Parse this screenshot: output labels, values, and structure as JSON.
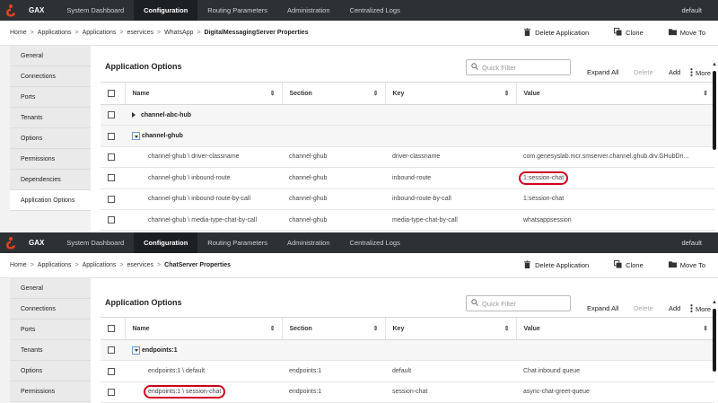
{
  "colors": {
    "nav_bg": "#2d3134",
    "nav_active_bg": "#1d2023",
    "logo": "#e8411e",
    "highlight_ring": "#d0021b",
    "sidebar_bg": "#eaeaea"
  },
  "panels": [
    {
      "nav": {
        "app_name": "GAX",
        "items": [
          "System Dashboard",
          "Configuration",
          "Routing Parameters",
          "Administration",
          "Centralized Logs"
        ],
        "active_index": 1,
        "user": "default"
      },
      "breadcrumb": {
        "items": [
          "Home",
          "Applications",
          "Applications",
          "eservices",
          "WhatsApp"
        ],
        "current": "DigitalMessagingServer Properties"
      },
      "actions": {
        "delete": "Delete Application",
        "clone": "Clone",
        "move": "Move To"
      },
      "sidebar": {
        "items": [
          "General",
          "Connections",
          "Ports",
          "Tenants",
          "Options",
          "Permissions",
          "Dependencies",
          "Application Options"
        ],
        "active_index": 7
      },
      "section_title": "Application Options",
      "filter_placeholder": "Quick Filter",
      "toolbar": {
        "expand_all": "Expand All",
        "delete": "Delete",
        "add": "Add",
        "more": "More"
      },
      "table": {
        "columns": [
          "Name",
          "Section",
          "Key",
          "Value"
        ],
        "rows": [
          {
            "type": "group",
            "name": "channel-abc-hub",
            "expanded": false
          },
          {
            "type": "group",
            "name": "channel-ghub",
            "expanded": true
          },
          {
            "type": "item",
            "name": "channel-ghub \\ driver-classname",
            "section": "channel-ghub",
            "key": "driver-classname",
            "value": "com.genesyslab.mcr.smserver.channel.ghub.drv.GHubDri..."
          },
          {
            "type": "item",
            "name": "channel-ghub \\ inbound-route",
            "section": "channel-ghub",
            "key": "inbound-route",
            "value": "1:session-chat",
            "highlight": "value"
          },
          {
            "type": "item",
            "name": "channel-ghub \\ inbound-route-by-call",
            "section": "channel-ghub",
            "key": "inbound-route-by-call",
            "value": "1:session-chat"
          },
          {
            "type": "item",
            "name": "channel-ghub \\ media-type-chat-by-call",
            "section": "channel-ghub",
            "key": "media-type-chat-by-call",
            "value": "whatsappsession"
          }
        ]
      }
    },
    {
      "nav": {
        "app_name": "GAX",
        "items": [
          "System Dashboard",
          "Configuration",
          "Routing Parameters",
          "Administration",
          "Centralized Logs"
        ],
        "active_index": 1,
        "user": "default"
      },
      "breadcrumb": {
        "items": [
          "Home",
          "Applications",
          "Applications",
          "eservices"
        ],
        "current": "ChatServer Properties"
      },
      "actions": {
        "delete": "Delete Application",
        "clone": "Clone",
        "move": "Move To"
      },
      "sidebar": {
        "items": [
          "General",
          "Connections",
          "Ports",
          "Tenants",
          "Options",
          "Permissions"
        ],
        "active_index": -1
      },
      "section_title": "Application Options",
      "filter_placeholder": "Quick Filter",
      "toolbar": {
        "expand_all": "Expand All",
        "delete": "Delete",
        "add": "Add",
        "more": "More"
      },
      "table": {
        "columns": [
          "Name",
          "Section",
          "Key",
          "Value"
        ],
        "rows": [
          {
            "type": "group",
            "name": "endpoints:1",
            "expanded": true
          },
          {
            "type": "item",
            "name": "endpoints:1 \\ default",
            "section": "endpoints:1",
            "key": "default",
            "value": "Chat inbound queue"
          },
          {
            "type": "item",
            "name": "endpoints:1 \\ session-chat",
            "section": "endpoints:1",
            "key": "session-chat",
            "value": "async-chat-greet-queue",
            "highlight": "name"
          }
        ]
      }
    }
  ]
}
